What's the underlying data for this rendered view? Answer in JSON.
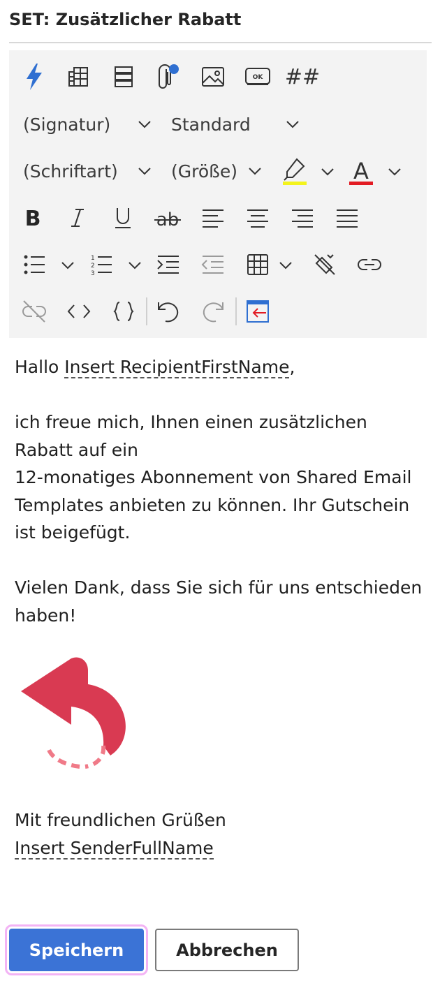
{
  "header": {
    "title": "SET: Zusätzlicher Rabatt"
  },
  "toolbar": {
    "row1": {
      "icons": [
        "lightning-icon",
        "table-grid-icon",
        "list-layout-icon",
        "attachment-icon",
        "image-icon",
        "ok-button-icon",
        "hashtag-icon"
      ],
      "hashtag_text": "##",
      "ok_text": "OK"
    },
    "signature_dropdown": "(Signatur)",
    "style_dropdown": "Standard",
    "font_dropdown": "(Schriftart)",
    "size_dropdown": "(Größe)",
    "highlight_color": "#f3f31c",
    "font_color": "#e21b23",
    "font_color_letter": "A",
    "accent_color": "#2f6fd1"
  },
  "editor": {
    "greeting_prefix": "Hallo ",
    "recipient_placeholder": "Insert RecipientFirstName",
    "greeting_suffix": ",",
    "body_lines": [
      "ich freue mich, Ihnen einen zusätzlichen",
      "Rabatt auf ein",
      "12-monatiges Abonnement von Shared Email",
      "Templates anbieten zu können. Ihr Gutschein",
      "ist beigefügt."
    ],
    "thanks_lines": [
      "Vielen Dank, dass Sie sich für uns entschieden",
      "haben!"
    ],
    "image_icon": "curved-arrow-back-icon",
    "image_color": "#d93a52",
    "closing": "Mit freundlichen Grüßen",
    "sender_placeholder": "Insert SenderFullName"
  },
  "actions": {
    "save_label": "Speichern",
    "cancel_label": "Abbrechen"
  }
}
